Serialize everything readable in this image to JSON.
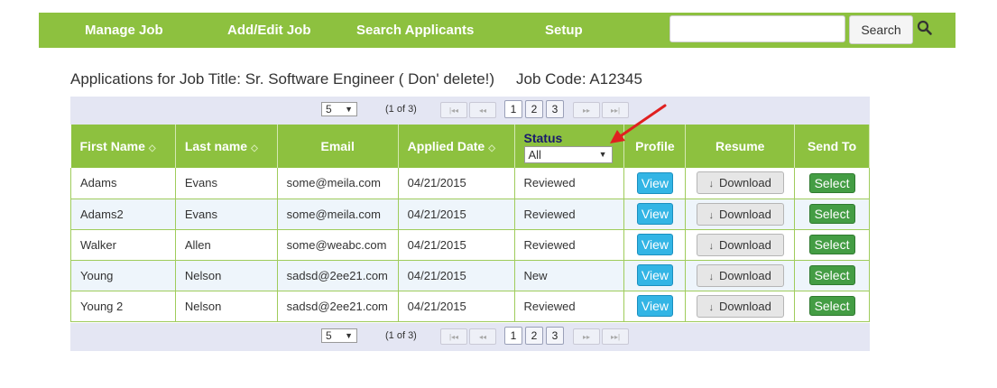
{
  "nav": {
    "items": [
      "Manage Job",
      "Add/Edit Job",
      "Search Applicants",
      "Setup"
    ],
    "search_value": "",
    "search_button": "Search",
    "search_icon": "search-icon",
    "color": "#8dc13f"
  },
  "heading": {
    "title": "Applications for Job Title: Sr. Software Engineer ( Don' delete!)",
    "code": "Job Code: A12345"
  },
  "pager": {
    "page_size": "5",
    "info": "(1 of 3)",
    "first": "|◂◂",
    "prev": "◂◂",
    "next": "▸▸",
    "last": "▸▸|",
    "pages": [
      "1",
      "2",
      "3"
    ],
    "current_page": "1"
  },
  "table": {
    "columns": {
      "first_name": "First Name",
      "last_name": "Last name",
      "email": "Email",
      "applied_date": "Applied Date",
      "status": "Status",
      "profile": "Profile",
      "resume": "Resume",
      "send_to": "Send To"
    },
    "status_filter": "All",
    "rows": [
      {
        "first": "Adams",
        "last": "Evans",
        "email": "some@meila.com",
        "date": "04/21/2015",
        "status": "Reviewed"
      },
      {
        "first": "Adams2",
        "last": "Evans",
        "email": "some@meila.com",
        "date": "04/21/2015",
        "status": "Reviewed"
      },
      {
        "first": "Walker",
        "last": "Allen",
        "email": "some@weabc.com",
        "date": "04/21/2015",
        "status": "Reviewed"
      },
      {
        "first": "Young",
        "last": "Nelson",
        "email": "sadsd@2ee21.com",
        "date": "04/21/2015",
        "status": "New"
      },
      {
        "first": "Young 2",
        "last": "Nelson",
        "email": "sadsd@2ee21.com",
        "date": "04/21/2015",
        "status": "Reviewed"
      }
    ],
    "view_label": "View",
    "download_label": "Download",
    "select_label": "Select"
  }
}
